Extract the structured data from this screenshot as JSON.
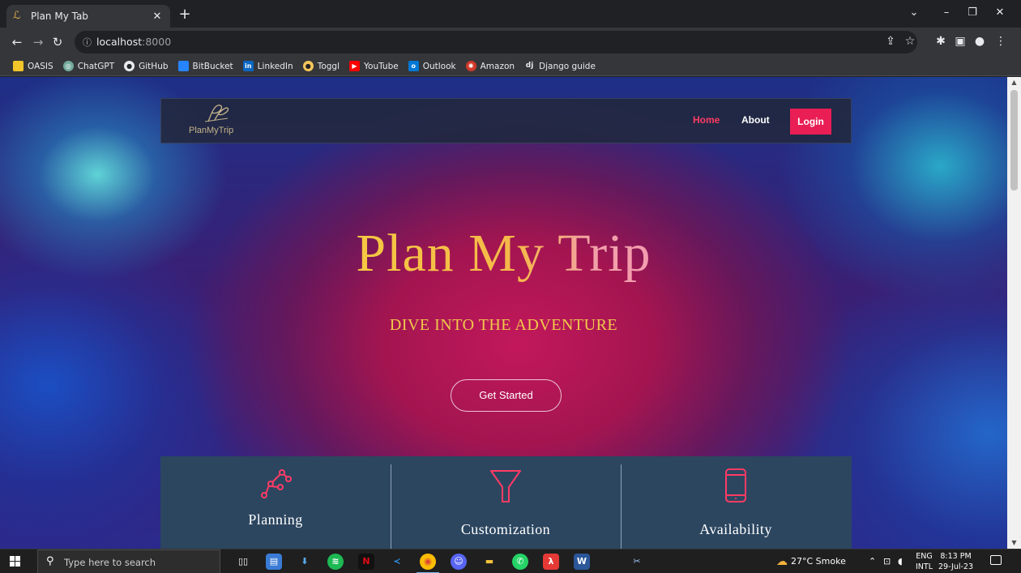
{
  "browser": {
    "tab_title": "Plan My Tab",
    "url_host": "localhost",
    "url_port": ":8000"
  },
  "bookmarks": [
    {
      "label": "OASIS",
      "color": "#f2c52b"
    },
    {
      "label": "ChatGPT",
      "color": "#74aa9c"
    },
    {
      "label": "GitHub",
      "color": "#24292e"
    },
    {
      "label": "BitBucket",
      "color": "#2684ff"
    },
    {
      "label": "LinkedIn",
      "color": "#0a66c2"
    },
    {
      "label": "Toggl",
      "color": "#e57cd8"
    },
    {
      "label": "YouTube",
      "color": "#ff0000"
    },
    {
      "label": "Outlook",
      "color": "#0078d4"
    },
    {
      "label": "Amazon",
      "color": "#ff9900"
    },
    {
      "label": "Django guide",
      "color": "#0c4b33"
    }
  ],
  "site": {
    "logo_text": "PlanMyTrip",
    "nav_home": "Home",
    "nav_about": "About",
    "login_label": "Login",
    "hero_title": "Plan My Trip",
    "hero_subtitle": "DIVE INTO THE ADVENTURE",
    "cta_label": "Get Started",
    "features": [
      {
        "title": "Planning",
        "icon": "route-icon"
      },
      {
        "title": "Customization",
        "icon": "filter-icon"
      },
      {
        "title": "Availability",
        "icon": "mobile-icon"
      }
    ],
    "accent_color": "#e91e55"
  },
  "taskbar": {
    "search_placeholder": "Type here to search",
    "weather": "27°C  Smoke",
    "lang_top": "ENG",
    "lang_bottom": "INTL",
    "time": "8:13 PM",
    "date": "29-Jul-23"
  }
}
